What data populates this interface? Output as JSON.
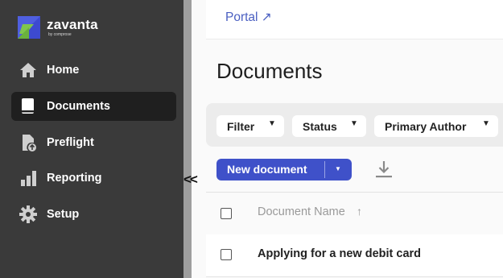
{
  "brand": {
    "name": "zavanta",
    "tagline": "by comprose",
    "colors": {
      "sidebar": "#3a3a3a",
      "accent": "#3f51c9",
      "link": "#4a5fc1",
      "logo_blue": "#4f5fe0",
      "logo_green": "#79c34a"
    }
  },
  "sidebar": {
    "items": [
      {
        "label": "Home",
        "icon": "home-icon",
        "active": false
      },
      {
        "label": "Documents",
        "icon": "document-icon",
        "active": true
      },
      {
        "label": "Preflight",
        "icon": "preflight-icon",
        "active": false
      },
      {
        "label": "Reporting",
        "icon": "bar-chart-icon",
        "active": false
      },
      {
        "label": "Setup",
        "icon": "gear-icon",
        "active": false
      }
    ],
    "collapse_label": "<<"
  },
  "header": {
    "portal_link": "Portal ↗"
  },
  "main": {
    "title": "Documents",
    "filters": [
      {
        "label": "Filter",
        "caret": "▼"
      },
      {
        "label": "Status",
        "caret": "▼"
      },
      {
        "label": "Primary Author",
        "caret": "▼"
      }
    ],
    "new_document_label": "New document",
    "new_document_caret": "▼",
    "download_icon": "download-icon",
    "table": {
      "columns": [
        {
          "label": "Document Name",
          "sort": "↑"
        }
      ],
      "rows": [
        {
          "name": "Applying for a new debit card"
        }
      ]
    }
  }
}
